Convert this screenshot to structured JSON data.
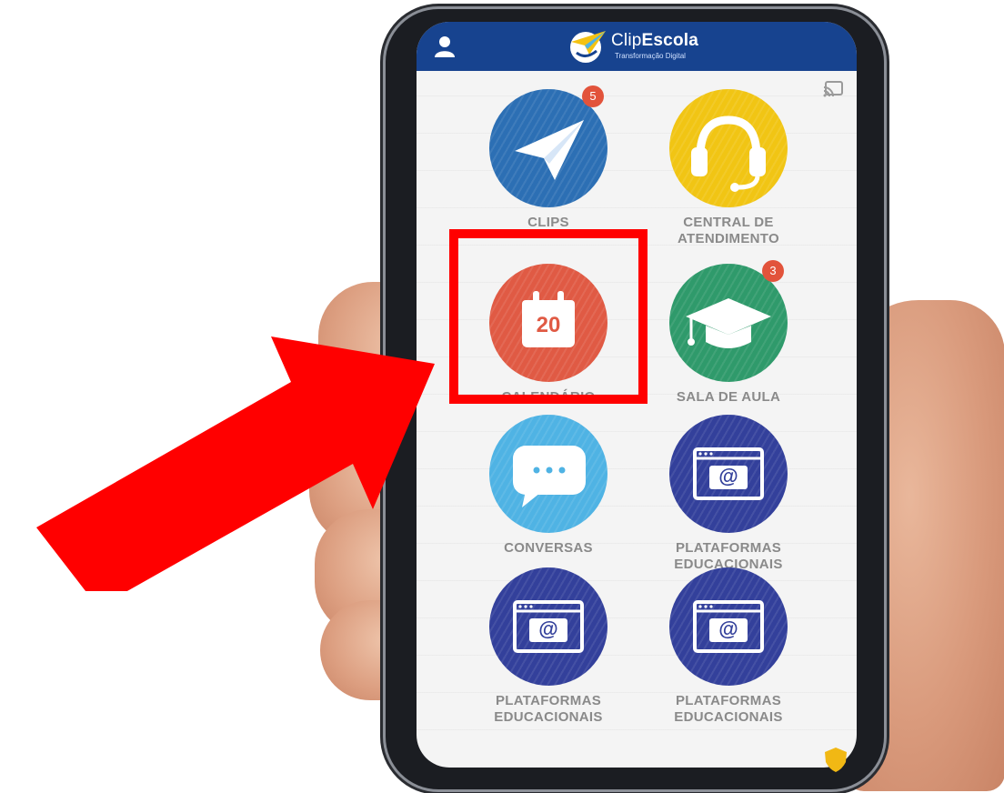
{
  "header": {
    "brand_prefix": "Clip",
    "brand_suffix": "Escola",
    "tagline": "Transformação Digital"
  },
  "apps": [
    {
      "label": "CLIPS",
      "badge": "5",
      "icon": "paper-plane-icon",
      "color": "#2c6fb4"
    },
    {
      "label": "CENTRAL DE ATENDIMENTO",
      "badge": null,
      "icon": "headset-icon",
      "color": "#f1c514"
    },
    {
      "label": "CALENDÁRIO",
      "badge": null,
      "icon": "calendar-icon",
      "icon_text": "20",
      "color": "#e05a44"
    },
    {
      "label": "SALA DE AULA",
      "badge": "3",
      "icon": "graduation-cap-icon",
      "color": "#2f9a6b"
    },
    {
      "label": "CONVERSAS",
      "badge": null,
      "icon": "chat-bubble-icon",
      "color": "#4fb3e4"
    },
    {
      "label": "PLATAFORMAS EDUCACIONAIS",
      "badge": null,
      "icon": "browser-at-icon",
      "icon_text": "@",
      "color": "#33409b"
    },
    {
      "label": "PLATAFORMAS EDUCACIONAIS",
      "badge": null,
      "icon": "browser-at-icon",
      "icon_text": "@",
      "color": "#33409b"
    },
    {
      "label": "PLATAFORMAS EDUCACIONAIS",
      "badge": null,
      "icon": "browser-at-icon",
      "icon_text": "@",
      "color": "#33409b"
    }
  ],
  "annotation": {
    "arrow_color": "#ff0000",
    "highlighted_item": "CALENDÁRIO"
  }
}
